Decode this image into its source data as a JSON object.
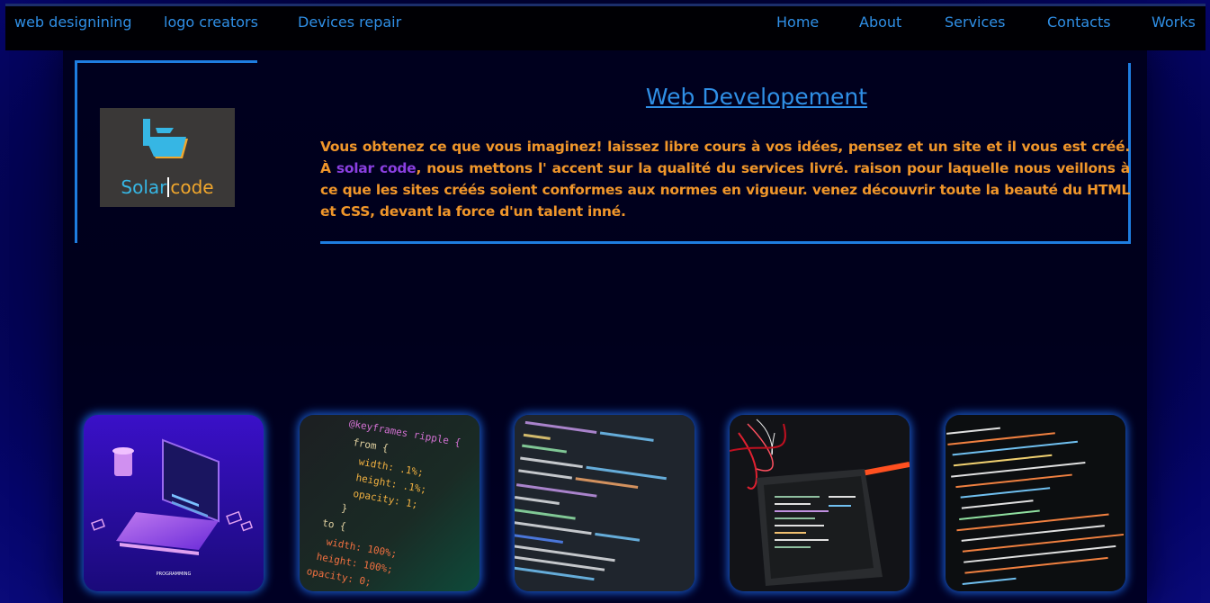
{
  "nav": {
    "left": [
      "web designining",
      "logo creators",
      "Devices repair"
    ],
    "right": [
      "Home",
      "About",
      "Services",
      "Contacts",
      "Works"
    ]
  },
  "hero": {
    "title": "Web Developement",
    "text_part1": "Vous obtenez ce que vous imaginez! laissez libre cours à vos idées, pensez et un site et il vous est créé. À ",
    "brand": "solar code",
    "text_part2": ", nous mettons l' accent sur la qualité du services livré. raison pour laquelle nous veillons à ce que les sites créés soient conformes aux normes en vigueur. venez découvrir toute la beauté du HTML et CSS, devant la force d'un talent inné."
  },
  "logo": {
    "word1": "Solar",
    "word2": "code",
    "colors": {
      "word1": "#36b6e4",
      "word2": "#f2a72c",
      "background": "#3a3837"
    }
  },
  "gallery": {
    "card1": {
      "caption": "PROGRAMMING"
    },
    "card2": {
      "code_lines": [
        "@keyframes ripple {",
        "from {",
        "width: .1%;",
        "height: .1%;",
        "opacity: 1;",
        "}",
        "to {",
        "width: 100%;",
        "height: 100%;",
        "opacity: 0;"
      ]
    }
  },
  "colors": {
    "accent": "#1e7de0",
    "nav_text": "#2f8fe6",
    "body_text": "#f0962a",
    "brand_text": "#8a3fe0"
  }
}
